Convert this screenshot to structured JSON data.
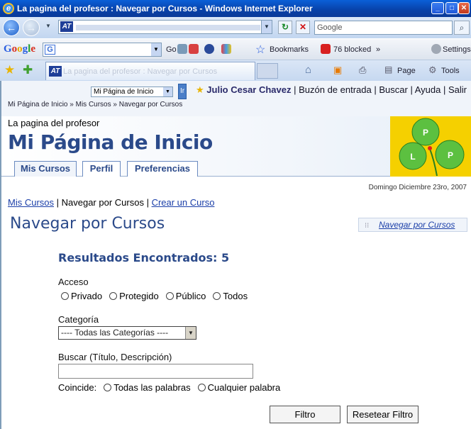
{
  "browser": {
    "window_title": "La pagina del profesor : Navegar por Cursos - Windows Internet Explorer",
    "search_placeholder": "Google",
    "google_toolbar": {
      "logo": "Google",
      "go_label": "Go",
      "bookmarks": "Bookmarks",
      "blocked": "76 blocked",
      "more": "»",
      "settings": "Settings"
    },
    "tab_title": "La pagina del profesor : Navegar por Cursos",
    "command_bar": {
      "page": "Page",
      "tools": "Tools"
    }
  },
  "site": {
    "home_select": "Mi Página de Inicio",
    "go_label": "Ir",
    "user_name": "Julio Cesar Chavez",
    "user_links": [
      "Buzón de entrada",
      "Buscar",
      "Ayuda",
      "Salir"
    ],
    "breadcrumb": "Mi Página de Inicio » Mis Cursos » Navegar por Cursos",
    "site_name": "La pagina del profesor",
    "page_heading": "Mi Página de Inicio",
    "tabs": [
      "Mis Cursos",
      "Perfil",
      "Preferencias"
    ],
    "date": "Domingo Diciembre 23ro, 2007",
    "logo_letters": [
      "P",
      "L",
      "P"
    ]
  },
  "main": {
    "crumb_links": [
      "Mis Cursos",
      "Navegar por Cursos",
      "Crear un Curso"
    ],
    "heading": "Navegar por Cursos",
    "side_link": "Navegar por Cursos",
    "results": "Resultados Encontrados: 5",
    "access_label": "Acceso",
    "access_options": [
      "Privado",
      "Protegido",
      "Público",
      "Todos"
    ],
    "category_label": "Categoría",
    "category_value": "---- Todas las Categorías ----",
    "search_label": "Buscar (Título, Descripción)",
    "search_value": "",
    "match_label": "Coincide:",
    "match_options": [
      "Todas las palabras",
      "Cualquier palabra"
    ],
    "filter_button": "Filtro",
    "reset_button": "Resetear Filtro"
  },
  "colors": {
    "heading_blue": "#2b4a8a",
    "link_blue": "#1a3ea8",
    "logo_yellow": "#f5d000",
    "logo_green": "#5cc040"
  }
}
